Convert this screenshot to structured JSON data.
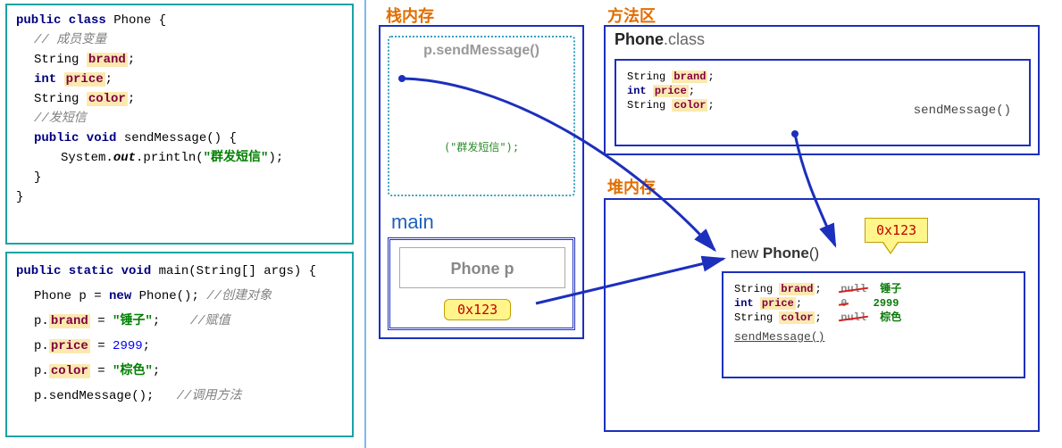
{
  "code_top": {
    "l1_kw1": "public class",
    "l1_cls": "Phone",
    "l1_brace": " {",
    "l2_comment": "// 成员变量",
    "l3_type": "String",
    "l3_field": "brand",
    "l3_semi": ";",
    "l4_type": "int",
    "l4_field": "price",
    "l4_semi": ";",
    "l5_type": "String",
    "l5_field": "color",
    "l5_semi": ";",
    "l6_comment": "//发短信",
    "l7_kw": "public void",
    "l7_name": " sendMessage() {",
    "l8_pre": "System.",
    "l8_out": "out",
    "l8_post": ".println(",
    "l8_str": "\"群发短信\"",
    "l8_end": ");",
    "l9_brace": "}",
    "l10_brace": "}"
  },
  "code_bottom": {
    "l1_kw": "public static void",
    "l1_rest": " main(String[] args) {",
    "l2_pre": "Phone p = ",
    "l2_new": "new",
    "l2_post": " Phone();",
    "l2_comment": " //创建对象",
    "l3_pre": "p.",
    "l3_field": "brand",
    "l3_mid": " = ",
    "l3_val": "\"锤子\"",
    "l3_semi": ";",
    "l3_pad": "    ",
    "l3_comment": "//赋值",
    "l4_pre": "p.",
    "l4_field": "price",
    "l4_mid": " = ",
    "l4_val": "2999",
    "l4_semi": ";",
    "l5_pre": "p.",
    "l5_field": "color",
    "l5_mid": " = ",
    "l5_val": "\"棕色\"",
    "l5_semi": ";",
    "l6_pre": "p.sendMessage();",
    "l6_pad": "   ",
    "l6_comment": "//调用方法"
  },
  "labels": {
    "stack": "栈内存",
    "method_area": "方法区",
    "heap": "堆内存"
  },
  "stack": {
    "frame_top": "p.sendMessage()",
    "frame_top_body": "(\"群发短信\");",
    "main_label": "main",
    "main_box_text": "Phone  p",
    "addr": "0x123"
  },
  "method_area": {
    "title_pre": "Phone",
    "title_post": ".class",
    "r1_type": "String",
    "r1_field": "brand",
    "r1_semi": ";",
    "r2_type": "int",
    "r2_field": "price",
    "r2_semi": ";",
    "r3_type": "String",
    "r3_field": "color",
    "r3_semi": ";",
    "method": "sendMessage()"
  },
  "heap": {
    "title_pre": "new ",
    "title_bold": "Phone",
    "title_post": "()",
    "bubble_addr": "0x123",
    "r1_type": "String",
    "r1_field": "brand",
    "r1_semi": ";",
    "r1_old": "null",
    "r1_new": "锤子",
    "r2_type": "int",
    "r2_field": "price",
    "r2_semi": ";",
    "r2_old": "0",
    "r2_new": "2999",
    "r3_type": "String",
    "r3_field": "color",
    "r3_semi": ";",
    "r3_old": "null",
    "r3_new": "棕色",
    "method": "sendMessage()"
  }
}
